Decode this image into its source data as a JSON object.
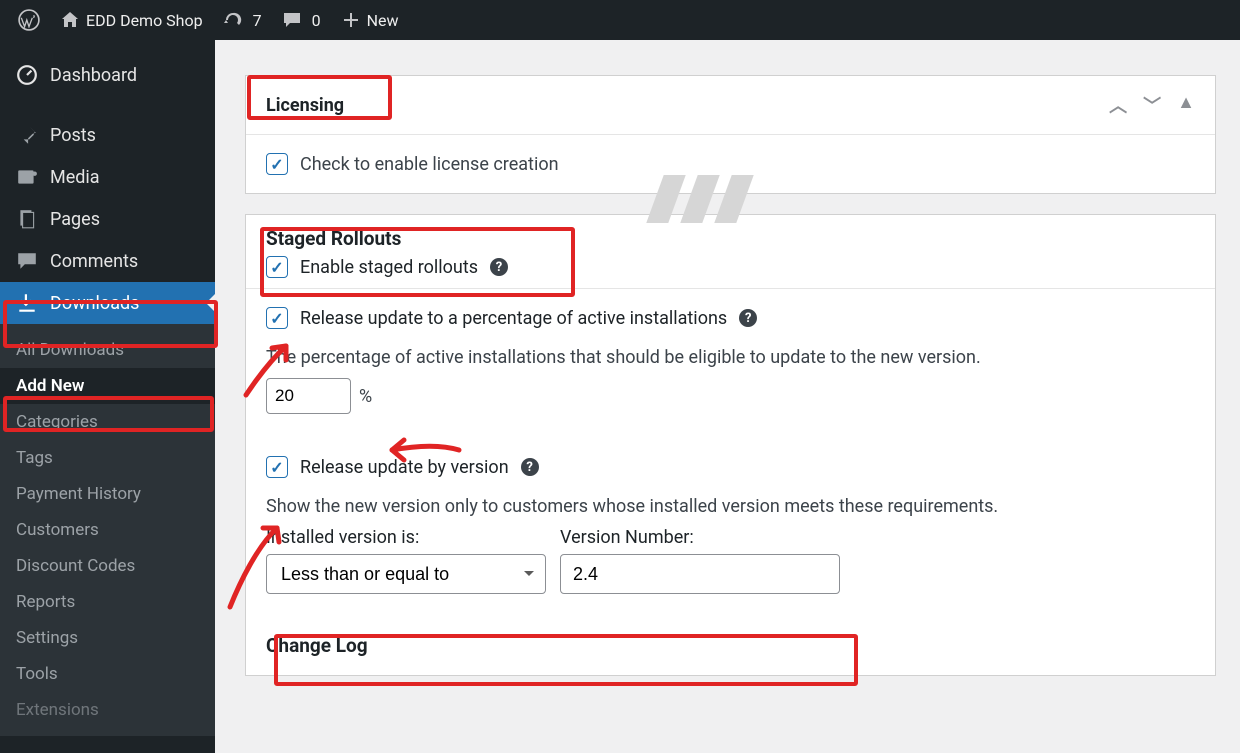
{
  "adminbar": {
    "site_name": "EDD Demo Shop",
    "updates": "7",
    "comments": "0",
    "new": "New"
  },
  "sidebar": {
    "items": [
      {
        "label": "Dashboard"
      },
      {
        "label": "Posts"
      },
      {
        "label": "Media"
      },
      {
        "label": "Pages"
      },
      {
        "label": "Comments"
      },
      {
        "label": "Downloads"
      }
    ],
    "submenu": [
      {
        "label": "All Downloads"
      },
      {
        "label": "Add New"
      },
      {
        "label": "Categories"
      },
      {
        "label": "Tags"
      },
      {
        "label": "Payment History"
      },
      {
        "label": "Customers"
      },
      {
        "label": "Discount Codes"
      },
      {
        "label": "Reports"
      },
      {
        "label": "Settings"
      },
      {
        "label": "Tools"
      },
      {
        "label": "Extensions"
      }
    ]
  },
  "licensing": {
    "title": "Licensing",
    "enable_label": "Check to enable license creation"
  },
  "staged": {
    "title": "Staged Rollouts",
    "enable_label": "Enable staged rollouts",
    "release_pct_label": "Release update to a percentage of active installations",
    "release_pct_desc": "The percentage of active installations that should be eligible to update to the new version.",
    "pct_value": "20",
    "pct_suffix": "%",
    "release_ver_label": "Release update by version",
    "release_ver_desc": "Show the new version only to customers whose installed version meets these requirements.",
    "installed_label": "Installed version is:",
    "version_label": "Version Number:",
    "operator": "Less than or equal to",
    "version_value": "2.4",
    "changelog_title": "Change Log"
  }
}
